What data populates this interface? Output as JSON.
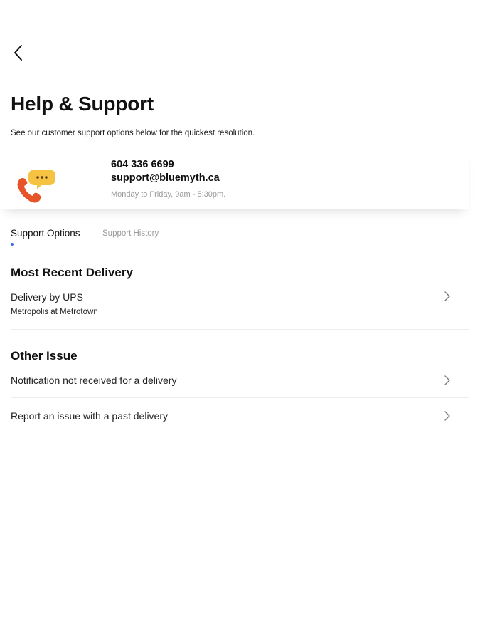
{
  "header": {
    "back_icon": "chevron-left-icon",
    "title": "Help & Support",
    "subtitle": "See our customer support options below for the quickest resolution."
  },
  "contact": {
    "icon": "phone-chat-icon",
    "phone": "604 336 6699",
    "email": "support@bluemyth.ca",
    "hours": "Monday to Friday, 9am - 5:30pm."
  },
  "tabs": [
    {
      "label": "Support Options",
      "active": true
    },
    {
      "label": "Support History",
      "active": false
    }
  ],
  "sections": {
    "recent": {
      "title": "Most Recent Delivery",
      "items": [
        {
          "title": "Delivery by UPS",
          "subtitle": "Metropolis at Metrotown"
        }
      ]
    },
    "other": {
      "title": "Other Issue",
      "items": [
        {
          "title": "Notification not received for a delivery"
        },
        {
          "title": "Report an issue with a past delivery"
        }
      ]
    }
  },
  "colors": {
    "accent": "#3d68e8",
    "phone_icon": "#e8542a",
    "chat_bubble": "#f5c242",
    "muted_text": "#9a9a9a"
  }
}
